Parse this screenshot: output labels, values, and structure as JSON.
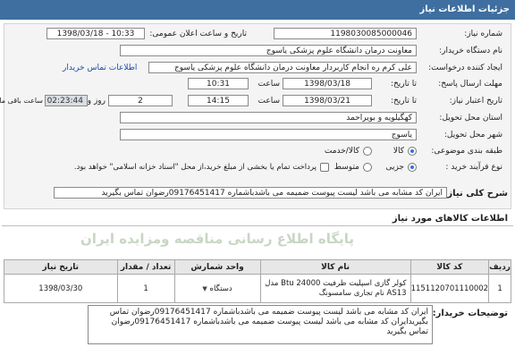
{
  "header": {
    "title": "جزئیات اطلاعات نیاز"
  },
  "form": {
    "need_number_label": "شماره نیاز:",
    "need_number": "1198030085000046",
    "announce_label": "تاریخ و ساعت اعلان عمومی:",
    "announce_value": "1398/03/18 - 10:33",
    "buyer_org_label": "نام دستگاه خریدار:",
    "buyer_org": "معاونت درمان دانشگاه علوم پزشکی یاسوج",
    "creator_label": "ایجاد کننده درخواست:",
    "creator": "علی کرم ره انجام  کاربردار معاونت درمان دانشگاه علوم پزشکی یاسوج",
    "contact_link": "اطلاعات تماس خریدار",
    "send_deadline_label": "مهلت ارسال پاسخ:",
    "send_deadline_to": "تا تاریخ:",
    "send_date": "1398/03/18",
    "time_label": "ساعت",
    "send_time": "10:31",
    "validity_label": "تاریخ اعتبار نیاز:",
    "validity_to": "تا تاریخ:",
    "validity_date": "1398/03/21",
    "validity_time": "14:15",
    "days_value": "2",
    "days_label": "روز و",
    "remaining": "02:23:44",
    "remaining_label": "ساعت باقی مانده",
    "province_label": "استان محل تحویل:",
    "province": "کهگیلویه و بویراحمد",
    "city_label": "شهر محل تحویل:",
    "city": "یاسوج",
    "category_label": "طبقه بندی موضوعی:",
    "category_options": [
      "کالا",
      "کالا/خدمت"
    ],
    "process_label": "نوع فرآیند خرید :",
    "process_options": [
      "جزیی",
      "متوسط"
    ],
    "payment_note": "پرداخت تمام یا بخشی از مبلغ خرید،از محل \"اسناد خزانه اسلامی\" خواهد بود."
  },
  "summary": {
    "label": "شرح کلی نیاز:",
    "text": "ایران کد مشابه می باشد لیست پیوست ضمیمه می باشدباشماره 09176451417رضوان تماس بگیرید"
  },
  "goods": {
    "title": "اطلاعات کالاهای مورد نیاز",
    "watermark": "پایگاه اطلاع رسانی مناقصه ومزایده ایران",
    "headers": [
      "ردیف",
      "کد کالا",
      "نام کالا",
      "واحد شمارش",
      "تعداد / مقدار",
      "تاریخ نیاز"
    ],
    "rows": [
      {
        "row": "1",
        "code": "1151120701110002",
        "name": "کولر گازی اسپلیت ظرفیت Btu 24000 مدل AS13 نام تجاری سامسونگ",
        "unit": "دستگاه",
        "qty": "1",
        "date": "1398/03/30"
      }
    ]
  },
  "notes": {
    "label": "توضیحات خریدار:",
    "text": "ایران کد مشابه می باشد لیست پیوست ضمیمه می باشدباشماره 09176451417رضوان تماس بگیریدایران کد مشابه می باشد لیست پیوست ضمیمه می باشدباشماره 09176451417رضوان تماس بگیرید"
  },
  "icons": {
    "dropdown": "chevron-down-icon"
  },
  "colors": {
    "header": "#3f6fa0",
    "link": "#1a4ea8"
  }
}
